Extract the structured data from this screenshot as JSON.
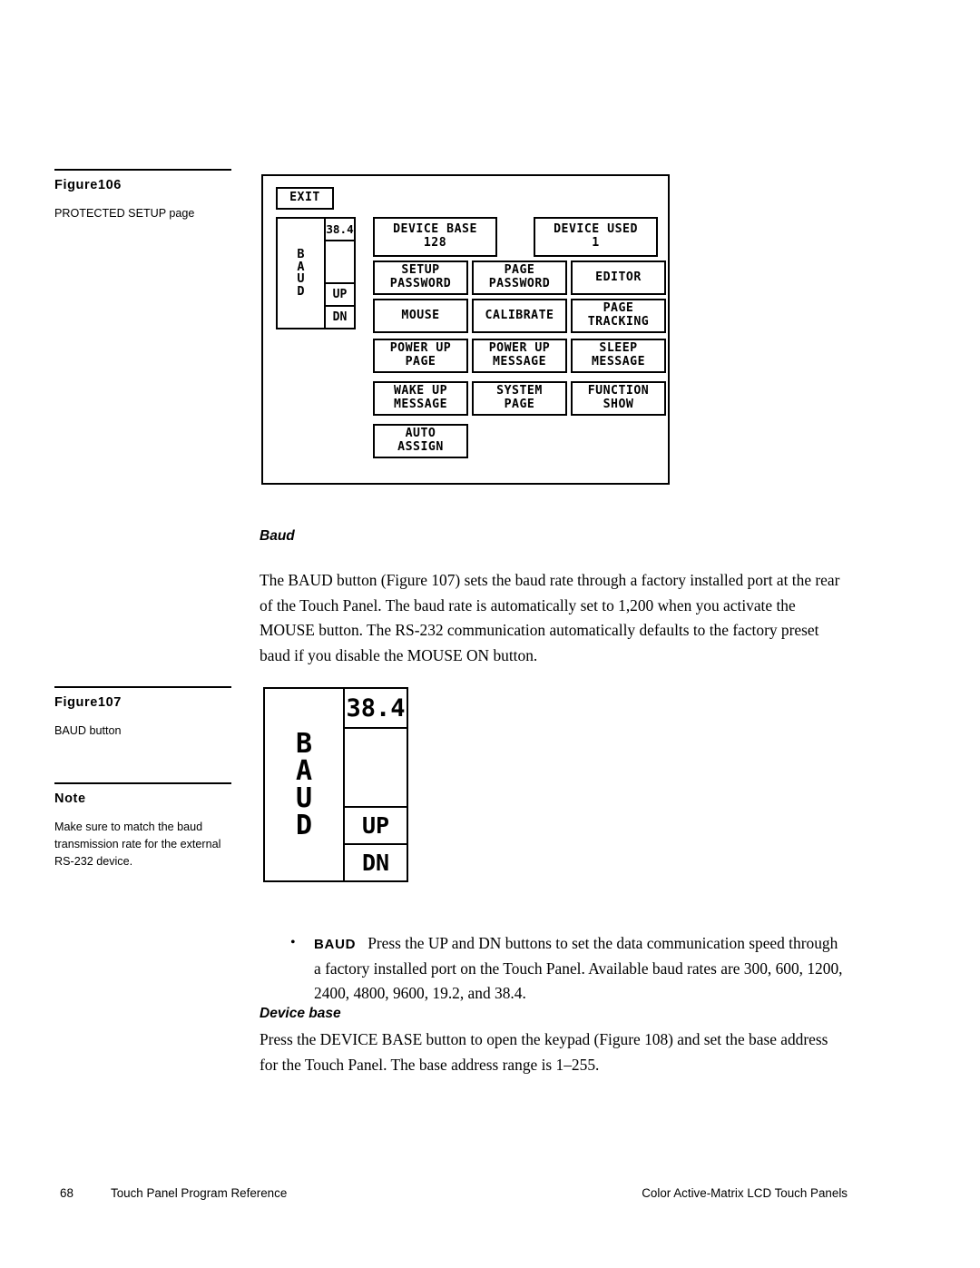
{
  "page": {
    "number": "68",
    "footer_left_title": "Touch Panel Program Reference",
    "footer_right_title": "Color Active-Matrix LCD Touch Panels"
  },
  "figure106": {
    "label": "Figure106",
    "caption": "PROTECTED SETUP page",
    "panel": {
      "exit_button": "EXIT",
      "baud": {
        "label_letters": [
          "B",
          "A",
          "U",
          "D"
        ],
        "value": "38.4",
        "up": "UP",
        "dn": "DN"
      },
      "buttons": [
        {
          "name": "device-base",
          "text": "DEVICE BASE\n128"
        },
        {
          "name": "device-used",
          "text": "DEVICE USED\n1"
        },
        {
          "name": "setup-password",
          "text": "SETUP\nPASSWORD"
        },
        {
          "name": "page-password",
          "text": "PAGE\nPASSWORD"
        },
        {
          "name": "editor",
          "text": "EDITOR"
        },
        {
          "name": "mouse",
          "text": "MOUSE"
        },
        {
          "name": "calibrate",
          "text": "CALIBRATE"
        },
        {
          "name": "page-tracking",
          "text": "PAGE\nTRACKING"
        },
        {
          "name": "power-up-page",
          "text": "POWER UP\nPAGE"
        },
        {
          "name": "power-up-message",
          "text": "POWER UP\nMESSAGE"
        },
        {
          "name": "sleep-message",
          "text": "SLEEP\nMESSAGE"
        },
        {
          "name": "wake-up-message",
          "text": "WAKE UP\nMESSAGE"
        },
        {
          "name": "system-page",
          "text": "SYSTEM\nPAGE"
        },
        {
          "name": "function-show",
          "text": "FUNCTION\nSHOW"
        },
        {
          "name": "auto-assign",
          "text": "AUTO\nASSIGN"
        }
      ]
    }
  },
  "baud_section": {
    "heading": "Baud",
    "paragraph": "The BAUD button (Figure 107) sets the baud rate through a factory installed port at the rear of the Touch Panel. The baud rate is automatically set to 1,200 when you activate the MOUSE button. The RS-232 communication automatically defaults to the factory preset baud if you disable the MOUSE ON button."
  },
  "figure107": {
    "label": "Figure107",
    "caption": "BAUD button",
    "widget": {
      "label_letters": [
        "B",
        "A",
        "U",
        "D"
      ],
      "value": "38.4",
      "up": "UP",
      "dn": "DN"
    }
  },
  "note": {
    "label": "Note",
    "text": "Make sure to match the baud transmission rate for the external RS-232 device."
  },
  "baud_bullet": {
    "bullet": "•",
    "term": "BAUD",
    "text": "Press the UP and DN buttons to set the data communication speed through a factory installed port on the Touch Panel. Available baud rates are 300, 600, 1200, 2400, 4800, 9600, 19.2, and 38.4."
  },
  "device_base_section": {
    "heading": "Device base",
    "paragraph": "Press the DEVICE BASE button to open the keypad (Figure 108) and set the base address for the Touch Panel. The base address range is 1–255."
  }
}
